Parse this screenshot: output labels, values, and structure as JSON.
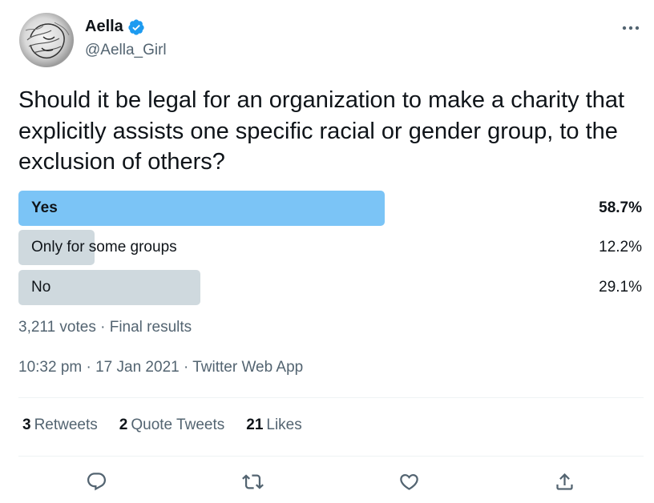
{
  "author": {
    "name": "Aella",
    "handle": "@Aella_Girl",
    "avatar_icon": "avatar-sketch-icon",
    "verified_color": "#1d9bf0"
  },
  "tweet": {
    "text": "Should it be legal for an organization to make a charity that explicitly assists one specific racial or gender group, to the exclusion of others?"
  },
  "poll": {
    "options": [
      {
        "label": "Yes",
        "percent_text": "58.7%",
        "percent": 58.7,
        "winner": true
      },
      {
        "label": "Only for some groups",
        "percent_text": "12.2%",
        "percent": 12.2,
        "winner": false
      },
      {
        "label": "No",
        "percent_text": "29.1%",
        "percent": 29.1,
        "winner": false
      }
    ],
    "winner_color": "#7bc4f6",
    "other_color": "#cfd9de",
    "meta": "3,211 votes · Final results"
  },
  "timestamp": "10:32 pm · 17 Jan 2021 · Twitter Web App",
  "stats": {
    "retweets_count": "3",
    "retweets_label": "Retweets",
    "quotes_count": "2",
    "quotes_label": "Quote Tweets",
    "likes_count": "21",
    "likes_label": "Likes"
  },
  "actions": [
    "reply-icon",
    "retweet-icon",
    "like-icon",
    "share-icon"
  ]
}
